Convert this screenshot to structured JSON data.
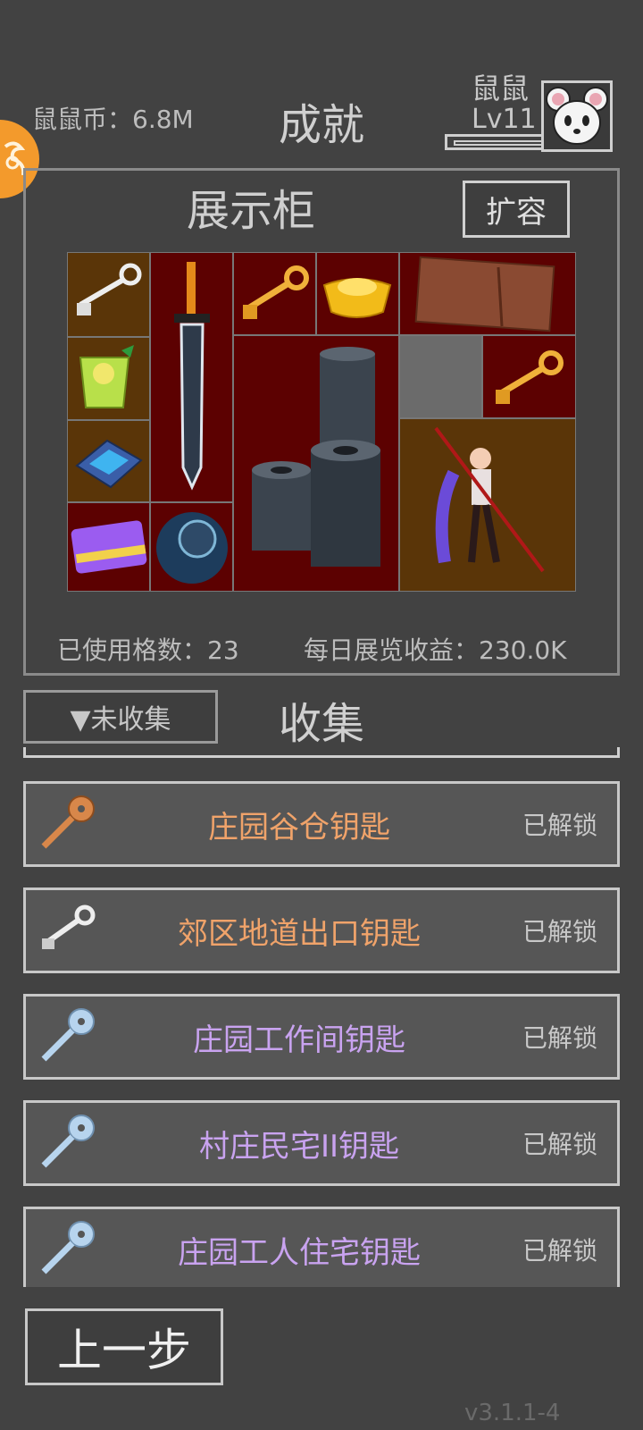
{
  "header": {
    "coins": "鼠鼠币：6.8M",
    "title": "成就",
    "player_name": "鼠鼠",
    "player_level": "Lv11"
  },
  "showcase": {
    "title": "展示柜",
    "expand_label": "扩容",
    "used_slots": "已使用格数：23",
    "daily_income": "每日展览收益：230.0K"
  },
  "collection": {
    "filter_label": "▼未收集",
    "title": "收集",
    "items": [
      {
        "name": "庄园谷仓钥匙",
        "status": "已解锁",
        "color": "#f0a36a",
        "icon": "copper-key-icon"
      },
      {
        "name": "郊区地道出口钥匙",
        "status": "已解锁",
        "color": "#f0a36a",
        "icon": "silver-key-icon"
      },
      {
        "name": "庄园工作间钥匙",
        "status": "已解锁",
        "color": "#c9a3f0",
        "icon": "blue-key-icon"
      },
      {
        "name": "村庄民宅II钥匙",
        "status": "已解锁",
        "color": "#c9a3f0",
        "icon": "blue-key-icon"
      },
      {
        "name": "庄园工人住宅钥匙",
        "status": "已解锁",
        "color": "#c9a3f0",
        "icon": "blue-key-icon"
      }
    ]
  },
  "footer": {
    "back_label": "上一步",
    "version": "v3.1.1-4"
  }
}
